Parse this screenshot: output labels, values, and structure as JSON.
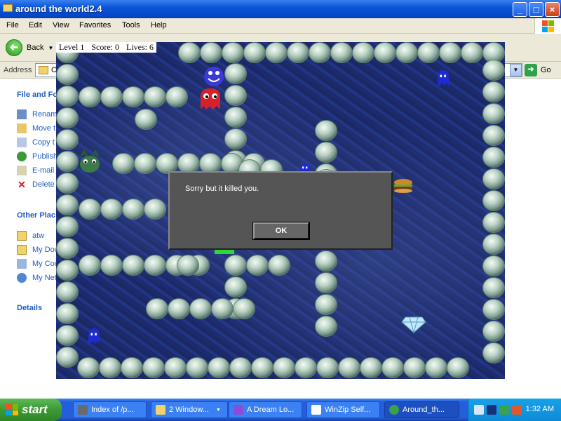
{
  "window": {
    "title": "around the world2.4",
    "minimize_glyph": "_",
    "maximize_glyph": "□",
    "close_glyph": "×"
  },
  "menu": [
    "File",
    "Edit",
    "View",
    "Favorites",
    "Tools",
    "Help"
  ],
  "toolbar": {
    "back_label": "Back",
    "back_arrow": "➜",
    "dropdown": "▼"
  },
  "address": {
    "label": "Address",
    "value": "C",
    "go_label": "Go",
    "go_arrow": "➜",
    "dropdown": "▼"
  },
  "sidebar": {
    "file_tasks_title": "File and Fo",
    "file_tasks": [
      {
        "label": "Rename",
        "icon": "rename-icon"
      },
      {
        "label": "Move t",
        "icon": "move-icon"
      },
      {
        "label": "Copy t",
        "icon": "copy-icon"
      },
      {
        "label": "Publish",
        "icon": "publish-icon"
      },
      {
        "label": "E-mail",
        "icon": "email-icon"
      },
      {
        "label": "Delete",
        "icon": "delete-icon"
      }
    ],
    "other_places_title": "Other Plac",
    "other_places": [
      {
        "label": "atw",
        "icon": "folder-icon"
      },
      {
        "label": "My Doc",
        "icon": "folder-icon"
      },
      {
        "label": "My Com",
        "icon": "computer-icon"
      },
      {
        "label": "My Net",
        "icon": "network-icon"
      }
    ],
    "details_title": "Details"
  },
  "game": {
    "hud": {
      "level": "Level  1",
      "score": "Score: 0",
      "lives": "Lives: 6"
    },
    "dialog": {
      "message": "Sorry but it killed you.",
      "ok_label": "OK"
    },
    "sprites": [
      {
        "name": "smiley-player-sprite",
        "color": "#3a3ad8"
      },
      {
        "name": "red-ghost-sprite",
        "color": "#d8202a"
      },
      {
        "name": "blue-ghost-sprite",
        "color": "#1d2bd0"
      },
      {
        "name": "green-monster-sprite",
        "color": "#3c7a4a"
      },
      {
        "name": "burger-sprite",
        "color": "#c98a2b"
      },
      {
        "name": "diamond-sprite",
        "color": "#bfe8ff"
      },
      {
        "name": "green-platform-sprite",
        "color": "#2fd63a"
      }
    ]
  },
  "taskbar": {
    "start_label": "start",
    "tasks": [
      {
        "label": "Index of /p...",
        "icon": "bug-icon",
        "active": false
      },
      {
        "label": "2 Window...",
        "icon": "folder-icon",
        "active": false,
        "dropdown": "▼"
      },
      {
        "label": "A Dream Lo...",
        "icon": "star-icon",
        "active": false
      },
      {
        "label": "WinZip Self...",
        "icon": "winzip-icon",
        "active": false
      },
      {
        "label": "Around_th...",
        "icon": "globe-icon",
        "active": true
      }
    ],
    "clock": "1:32 AM"
  }
}
